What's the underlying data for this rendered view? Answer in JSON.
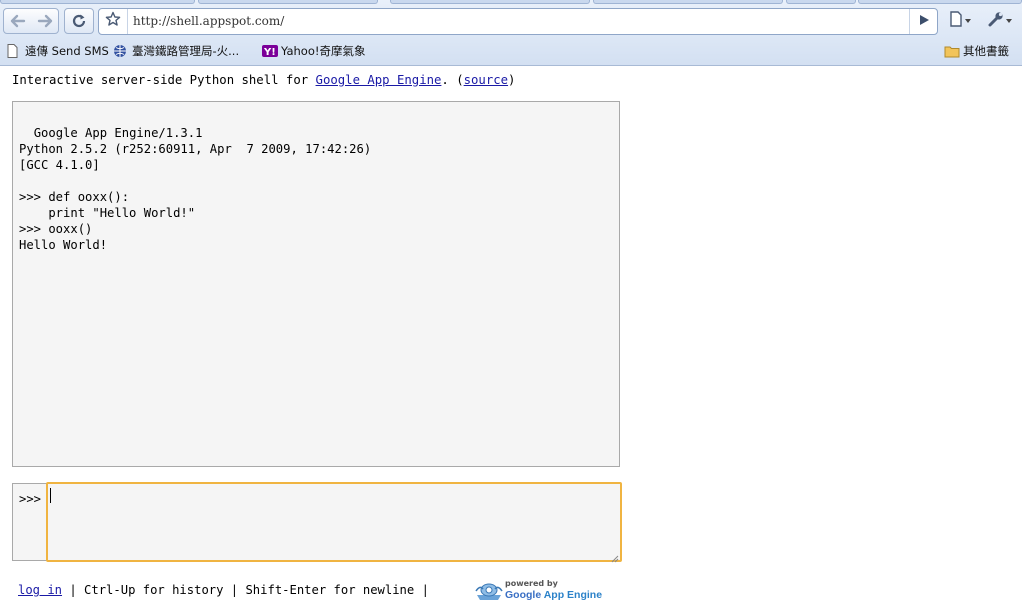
{
  "browser": {
    "url": "http://shell.appspot.com/",
    "bookmarks": [
      {
        "label": "遠傳 Send SMS",
        "icon": "page-icon"
      },
      {
        "label": "臺灣鐵路管理局-火...",
        "icon": "globe-icon"
      },
      {
        "label": "Yahoo!奇摩氣象",
        "icon": "yahoo-icon"
      }
    ],
    "other_bookmarks": "其他書籤"
  },
  "page": {
    "intro_prefix": "Interactive server-side Python shell for ",
    "intro_link": "Google App Engine",
    "intro_middle": ". (",
    "source_link": "source",
    "intro_suffix": ")",
    "output": "Google App Engine/1.3.1\nPython 2.5.2 (r252:60911, Apr  7 2009, 17:42:26)\n[GCC 4.1.0]\n\n>>> def ooxx():\n    print \"Hello World!\"\n>>> ooxx()\nHello World!",
    "prompt": ">>>",
    "input_value": "",
    "footer": {
      "login": "log in",
      "text": " | Ctrl-Up for history | Shift-Enter for newline | ",
      "badge_small": "powered by",
      "badge_google": "Google",
      "badge_engine": " App Engine"
    }
  },
  "colors": {
    "link": "#1a1aa6",
    "input_focus_border": "#f0b441",
    "panel_bg": "#f5f5f5"
  }
}
